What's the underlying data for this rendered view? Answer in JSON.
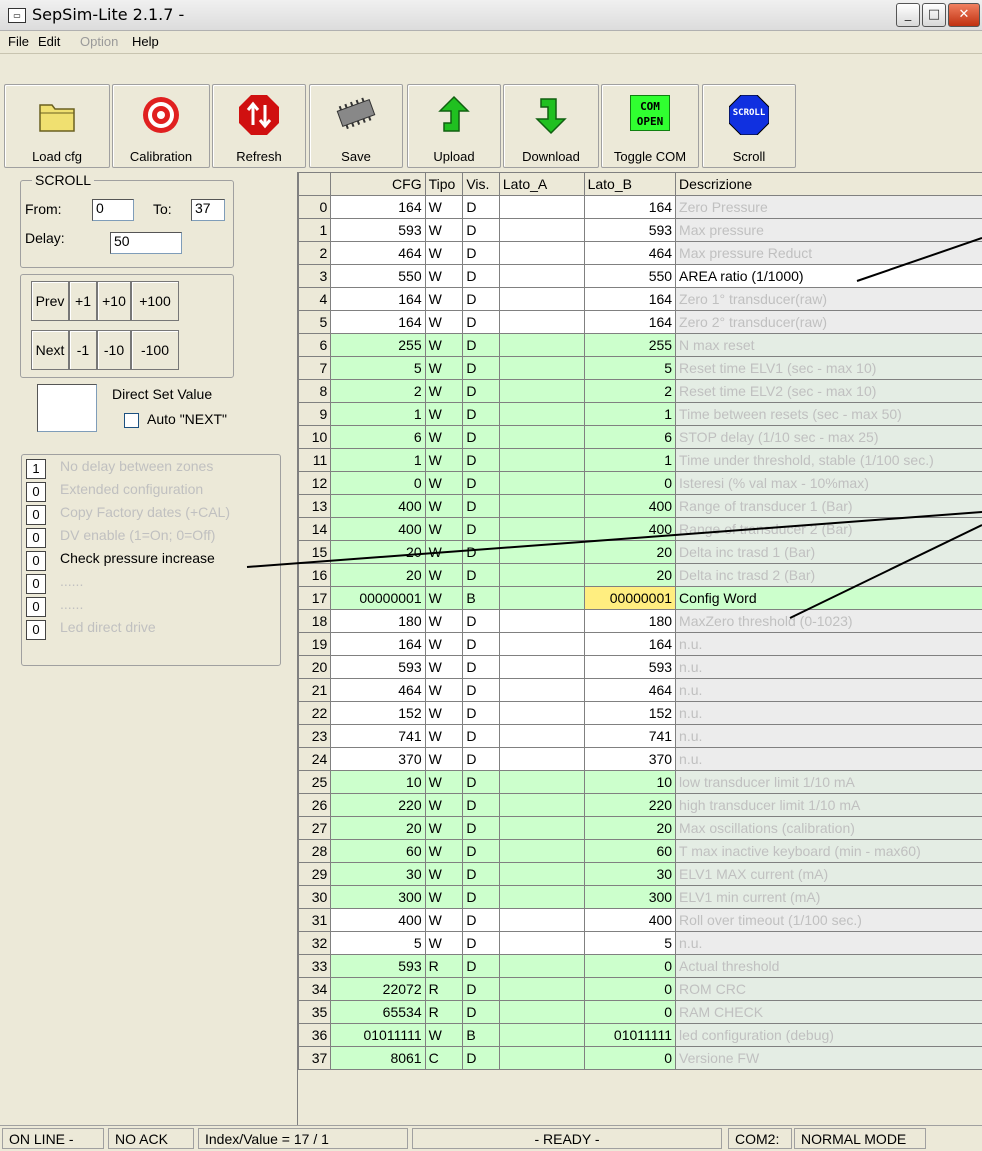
{
  "window": {
    "title": "SepSim-Lite 2.1.7 -"
  },
  "menu": [
    {
      "label": "File",
      "enabled": true
    },
    {
      "label": "Edit",
      "enabled": true
    },
    {
      "label": "Option",
      "enabled": false
    },
    {
      "label": "Help",
      "enabled": true
    }
  ],
  "toolbar": {
    "load": "Load cfg",
    "calibration": "Calibration",
    "refresh": "Refresh",
    "save": "Save",
    "upload": "Upload",
    "download": "Download",
    "toggle_com": "Toggle COM",
    "toggle_com_icon": "COM\nOPEN",
    "scroll": "Scroll",
    "scroll_icon": "SCROLL"
  },
  "scroll": {
    "legend": "SCROLL",
    "from_label": "From:",
    "from_value": "0",
    "to_label": "To:",
    "to_value": "37",
    "delay_label": "Delay:",
    "delay_value": "50"
  },
  "nav": {
    "prev": "Prev",
    "p1": "+1",
    "p10": "+10",
    "p100": "+100",
    "next": "Next",
    "m1": "-1",
    "m10": "-10",
    "m100": "-100"
  },
  "direct": {
    "label": "Direct Set Value",
    "value": "",
    "auto_next": "Auto \"NEXT\""
  },
  "flags": [
    {
      "value": "1",
      "label": "No delay between zones",
      "enabled": false
    },
    {
      "value": "0",
      "label": "Extended configuration",
      "enabled": false
    },
    {
      "value": "0",
      "label": "Copy Factory dates (+CAL)",
      "enabled": false
    },
    {
      "value": "0",
      "label": "DV enable (1=On; 0=Off)",
      "enabled": false
    },
    {
      "value": "0",
      "label": "Check pressure increase",
      "enabled": true
    },
    {
      "value": "0",
      "label": "......",
      "enabled": false
    },
    {
      "value": "0",
      "label": "......",
      "enabled": false
    },
    {
      "value": "0",
      "label": "Led direct drive",
      "enabled": false
    }
  ],
  "grid": {
    "columns": [
      "",
      "CFG",
      "Tipo",
      "Vis.",
      "Lato_A",
      "Lato_B",
      "Descrizione"
    ],
    "rows": [
      {
        "i": "0",
        "cfg": "164",
        "tipo": "W",
        "vis": "D",
        "a": "",
        "b": "164",
        "desc": "Zero Pressure",
        "on": false,
        "green": false
      },
      {
        "i": "1",
        "cfg": "593",
        "tipo": "W",
        "vis": "D",
        "a": "",
        "b": "593",
        "desc": "Max pressure",
        "on": false,
        "green": false
      },
      {
        "i": "2",
        "cfg": "464",
        "tipo": "W",
        "vis": "D",
        "a": "",
        "b": "464",
        "desc": "Max pressure Reduct",
        "on": false,
        "green": false
      },
      {
        "i": "3",
        "cfg": "550",
        "tipo": "W",
        "vis": "D",
        "a": "",
        "b": "550",
        "desc": "AREA ratio (1/1000)",
        "on": true,
        "green": false
      },
      {
        "i": "4",
        "cfg": "164",
        "tipo": "W",
        "vis": "D",
        "a": "",
        "b": "164",
        "desc": "Zero 1° transducer(raw)",
        "on": false,
        "green": false
      },
      {
        "i": "5",
        "cfg": "164",
        "tipo": "W",
        "vis": "D",
        "a": "",
        "b": "164",
        "desc": "Zero 2° transducer(raw)",
        "on": false,
        "green": false
      },
      {
        "i": "6",
        "cfg": "255",
        "tipo": "W",
        "vis": "D",
        "a": "",
        "b": "255",
        "desc": "N max reset",
        "on": false,
        "green": true
      },
      {
        "i": "7",
        "cfg": "5",
        "tipo": "W",
        "vis": "D",
        "a": "",
        "b": "5",
        "desc": "Reset time ELV1 (sec - max 10)",
        "on": false,
        "green": true
      },
      {
        "i": "8",
        "cfg": "2",
        "tipo": "W",
        "vis": "D",
        "a": "",
        "b": "2",
        "desc": "Reset time ELV2 (sec - max 10)",
        "on": false,
        "green": true
      },
      {
        "i": "9",
        "cfg": "1",
        "tipo": "W",
        "vis": "D",
        "a": "",
        "b": "1",
        "desc": "Time between resets (sec - max 50)",
        "on": false,
        "green": true
      },
      {
        "i": "10",
        "cfg": "6",
        "tipo": "W",
        "vis": "D",
        "a": "",
        "b": "6",
        "desc": "STOP delay (1/10 sec - max 25)",
        "on": false,
        "green": true
      },
      {
        "i": "11",
        "cfg": "1",
        "tipo": "W",
        "vis": "D",
        "a": "",
        "b": "1",
        "desc": "Time under threshold, stable (1/100 sec.)",
        "on": false,
        "green": true
      },
      {
        "i": "12",
        "cfg": "0",
        "tipo": "W",
        "vis": "D",
        "a": "",
        "b": "0",
        "desc": "Isteresi (% val max - 10%max)",
        "on": false,
        "green": true
      },
      {
        "i": "13",
        "cfg": "400",
        "tipo": "W",
        "vis": "D",
        "a": "",
        "b": "400",
        "desc": "Range of transducer 1 (Bar)",
        "on": false,
        "green": true
      },
      {
        "i": "14",
        "cfg": "400",
        "tipo": "W",
        "vis": "D",
        "a": "",
        "b": "400",
        "desc": "Range of transducer 2 (Bar)",
        "on": false,
        "green": true
      },
      {
        "i": "15",
        "cfg": "20",
        "tipo": "W",
        "vis": "D",
        "a": "",
        "b": "20",
        "desc": "Delta inc trasd 1 (Bar)",
        "on": false,
        "green": true
      },
      {
        "i": "16",
        "cfg": "20",
        "tipo": "W",
        "vis": "D",
        "a": "",
        "b": "20",
        "desc": "Delta inc trasd 2 (Bar)",
        "on": false,
        "green": true
      },
      {
        "i": "17",
        "cfg": "00000001",
        "tipo": "W",
        "vis": "B",
        "a": "",
        "b": "00000001",
        "desc": "Config Word",
        "on": true,
        "green": true,
        "selected": true
      },
      {
        "i": "18",
        "cfg": "180",
        "tipo": "W",
        "vis": "D",
        "a": "",
        "b": "180",
        "desc": "MaxZero threshold (0-1023)",
        "on": false,
        "green": false
      },
      {
        "i": "19",
        "cfg": "164",
        "tipo": "W",
        "vis": "D",
        "a": "",
        "b": "164",
        "desc": "n.u.",
        "on": false,
        "green": false
      },
      {
        "i": "20",
        "cfg": "593",
        "tipo": "W",
        "vis": "D",
        "a": "",
        "b": "593",
        "desc": "n.u.",
        "on": false,
        "green": false
      },
      {
        "i": "21",
        "cfg": "464",
        "tipo": "W",
        "vis": "D",
        "a": "",
        "b": "464",
        "desc": "n.u.",
        "on": false,
        "green": false
      },
      {
        "i": "22",
        "cfg": "152",
        "tipo": "W",
        "vis": "D",
        "a": "",
        "b": "152",
        "desc": "n.u.",
        "on": false,
        "green": false
      },
      {
        "i": "23",
        "cfg": "741",
        "tipo": "W",
        "vis": "D",
        "a": "",
        "b": "741",
        "desc": "n.u.",
        "on": false,
        "green": false
      },
      {
        "i": "24",
        "cfg": "370",
        "tipo": "W",
        "vis": "D",
        "a": "",
        "b": "370",
        "desc": "n.u.",
        "on": false,
        "green": false
      },
      {
        "i": "25",
        "cfg": "10",
        "tipo": "W",
        "vis": "D",
        "a": "",
        "b": "10",
        "desc": "low transducer limit 1/10 mA",
        "on": false,
        "green": true
      },
      {
        "i": "26",
        "cfg": "220",
        "tipo": "W",
        "vis": "D",
        "a": "",
        "b": "220",
        "desc": "high transducer limit 1/10 mA",
        "on": false,
        "green": true
      },
      {
        "i": "27",
        "cfg": "20",
        "tipo": "W",
        "vis": "D",
        "a": "",
        "b": "20",
        "desc": "Max oscillations (calibration)",
        "on": false,
        "green": true
      },
      {
        "i": "28",
        "cfg": "60",
        "tipo": "W",
        "vis": "D",
        "a": "",
        "b": "60",
        "desc": "T max inactive keyboard (min - max60)",
        "on": false,
        "green": true
      },
      {
        "i": "29",
        "cfg": "30",
        "tipo": "W",
        "vis": "D",
        "a": "",
        "b": "30",
        "desc": "ELV1 MAX current (mA)",
        "on": false,
        "green": true
      },
      {
        "i": "30",
        "cfg": "300",
        "tipo": "W",
        "vis": "D",
        "a": "",
        "b": "300",
        "desc": "ELV1 min current (mA)",
        "on": false,
        "green": true
      },
      {
        "i": "31",
        "cfg": "400",
        "tipo": "W",
        "vis": "D",
        "a": "",
        "b": "400",
        "desc": "Roll over timeout (1/100 sec.)",
        "on": false,
        "green": false
      },
      {
        "i": "32",
        "cfg": "5",
        "tipo": "W",
        "vis": "D",
        "a": "",
        "b": "5",
        "desc": "n.u.",
        "on": false,
        "green": false
      },
      {
        "i": "33",
        "cfg": "593",
        "tipo": "R",
        "vis": "D",
        "a": "",
        "b": "0",
        "desc": "Actual threshold",
        "on": false,
        "green": true
      },
      {
        "i": "34",
        "cfg": "22072",
        "tipo": "R",
        "vis": "D",
        "a": "",
        "b": "0",
        "desc": "ROM CRC",
        "on": false,
        "green": true
      },
      {
        "i": "35",
        "cfg": "65534",
        "tipo": "R",
        "vis": "D",
        "a": "",
        "b": "0",
        "desc": "RAM CHECK",
        "on": false,
        "green": true
      },
      {
        "i": "36",
        "cfg": "01011111",
        "tipo": "W",
        "vis": "B",
        "a": "",
        "b": "01011111",
        "desc": "led configuration (debug)",
        "on": false,
        "green": true
      },
      {
        "i": "37",
        "cfg": "8061",
        "tipo": "C",
        "vis": "D",
        "a": "",
        "b": "0",
        "desc": "Versione FW",
        "on": false,
        "green": true
      }
    ]
  },
  "status": {
    "online": "ON LINE  -",
    "ack": "NO ACK",
    "index": "Index/Value = 17 / 1",
    "ready": "- READY -",
    "com": "COM2:",
    "mode": "NORMAL MODE"
  }
}
